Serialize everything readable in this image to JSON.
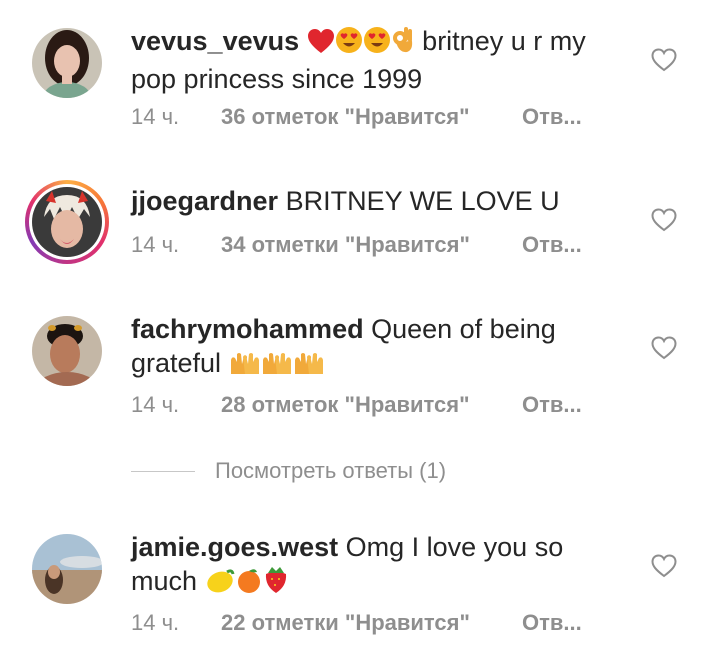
{
  "comments": [
    {
      "username": "vevus_vevus",
      "text_line1_suffix": "britney u r my",
      "text_line2": "pop princess since 1999",
      "emojis": [
        "red-heart",
        "heart-eyes",
        "heart-eyes",
        "ok-hand"
      ],
      "time": "14 ч.",
      "likes": "36 отметок \"Нравится\"",
      "reply": "Отв..."
    },
    {
      "username": "jjoegardner",
      "text": "BRITNEY WE LOVE U",
      "time": "14 ч.",
      "likes": "34 отметки \"Нравится\"",
      "reply": "Отв...",
      "has_story": true
    },
    {
      "username": "fachrymohammed",
      "text_line1": "Queen of being",
      "text_line2": "grateful",
      "emojis": [
        "raised-hands",
        "raised-hands",
        "raised-hands"
      ],
      "time": "14 ч.",
      "likes": "28 отметок \"Нравится\"",
      "reply": "Отв..."
    },
    {
      "username": "jamie.goes.west",
      "text_line1": "Omg I love you so",
      "text_line2": "much",
      "emojis": [
        "lemon",
        "tangerine",
        "strawberry"
      ],
      "time": "14 ч.",
      "likes": "22 отметки \"Нравится\"",
      "reply": "Отв..."
    }
  ],
  "view_replies": "Посмотреть ответы (1)",
  "colors": {
    "text": "#262626",
    "secondary": "#8e8e8e",
    "heart_outline": "#8e8e8e"
  }
}
